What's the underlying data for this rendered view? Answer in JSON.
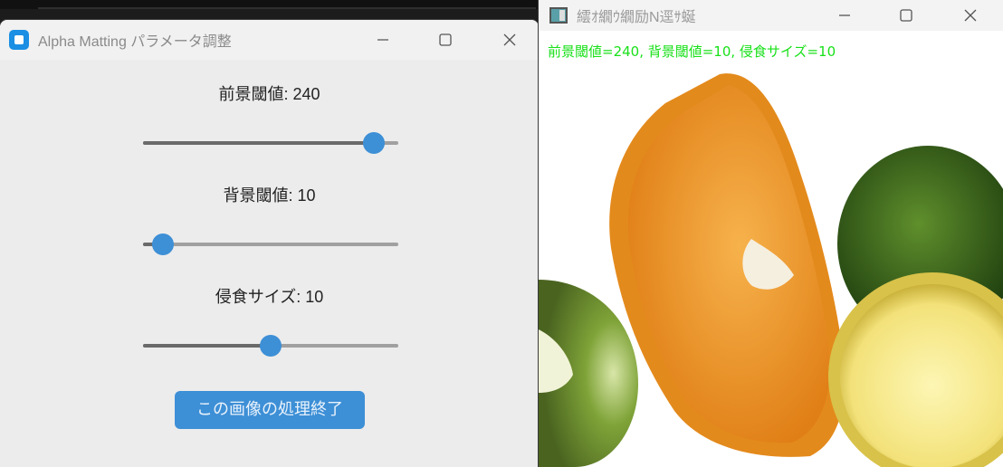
{
  "left_window": {
    "title": "Alpha Matting パラメータ調整",
    "controls": {
      "minimize": "minimize-icon",
      "maximize": "maximize-icon",
      "close": "close-icon"
    },
    "sliders": [
      {
        "label": "前景閾値: 240",
        "value": 240,
        "min": 0,
        "max": 255
      },
      {
        "label": "背景閾値: 10",
        "value": 10,
        "min": 0,
        "max": 255
      },
      {
        "label": "侵食サイズ: 10",
        "value": 10,
        "min": 0,
        "max": 20
      }
    ],
    "finish_button": "この画像の処理終了"
  },
  "right_window": {
    "title": "繧ｵ繝ｳ繝励Ν逕ｻ蜒",
    "overlay": "前景閾値=240, 背景閾値=10, 侵食サイズ=10"
  },
  "colors": {
    "accent": "#3d8fd6",
    "overlay_text": "#18e018"
  }
}
